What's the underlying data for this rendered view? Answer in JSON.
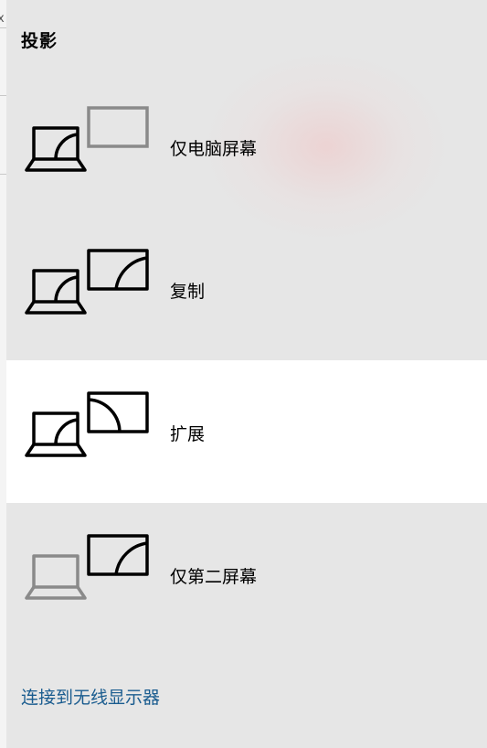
{
  "panel": {
    "title": "投影",
    "options": [
      {
        "id": "pc-only",
        "label": "仅电脑屏幕",
        "selected": false
      },
      {
        "id": "duplicate",
        "label": "复制",
        "selected": false
      },
      {
        "id": "extend",
        "label": "扩展",
        "selected": true
      },
      {
        "id": "second-only",
        "label": "仅第二屏幕",
        "selected": false
      }
    ],
    "connect_link": "连接到无线显示器"
  },
  "background": {
    "edge_glyph": "x"
  },
  "colors": {
    "panel_bg": "#e6e6e6",
    "selected_bg": "#ffffff",
    "icon_active": "#000000",
    "icon_inactive": "#8a8a8a",
    "link": "#1a5c8f"
  }
}
